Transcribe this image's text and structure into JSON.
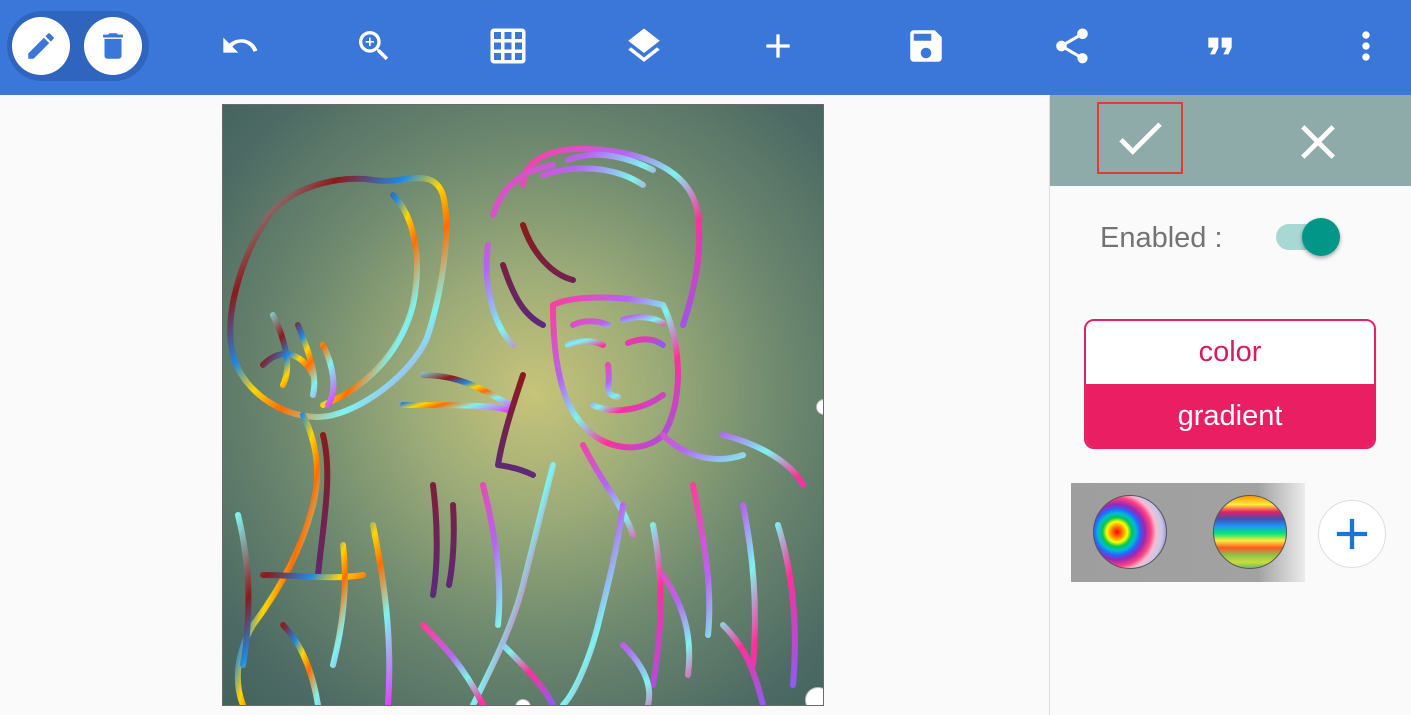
{
  "toolbar": {
    "background": "#3a77d9",
    "modes": [
      {
        "icon": "pencil-icon",
        "active": true
      },
      {
        "icon": "trash-icon",
        "active": false
      }
    ],
    "actions": [
      "undo-icon",
      "zoom-in-icon",
      "grid-icon",
      "layers-icon",
      "add-icon",
      "save-icon",
      "share-icon",
      "quote-icon",
      "more-vert-icon"
    ]
  },
  "canvas": {
    "description_icon": "sketch-artwork"
  },
  "panel": {
    "header_background": "#8eaaa9",
    "confirm_icon": "check-icon",
    "cancel_icon": "close-icon",
    "enabled_label": "Enabled :",
    "enabled": true,
    "segments": {
      "options": [
        "color",
        "gradient"
      ],
      "selected": "gradient"
    },
    "accent": "#e91e63",
    "swatches": [
      "radial-gradient-swatch",
      "linear-gradient-swatch"
    ],
    "add_icon": "plus-icon"
  }
}
